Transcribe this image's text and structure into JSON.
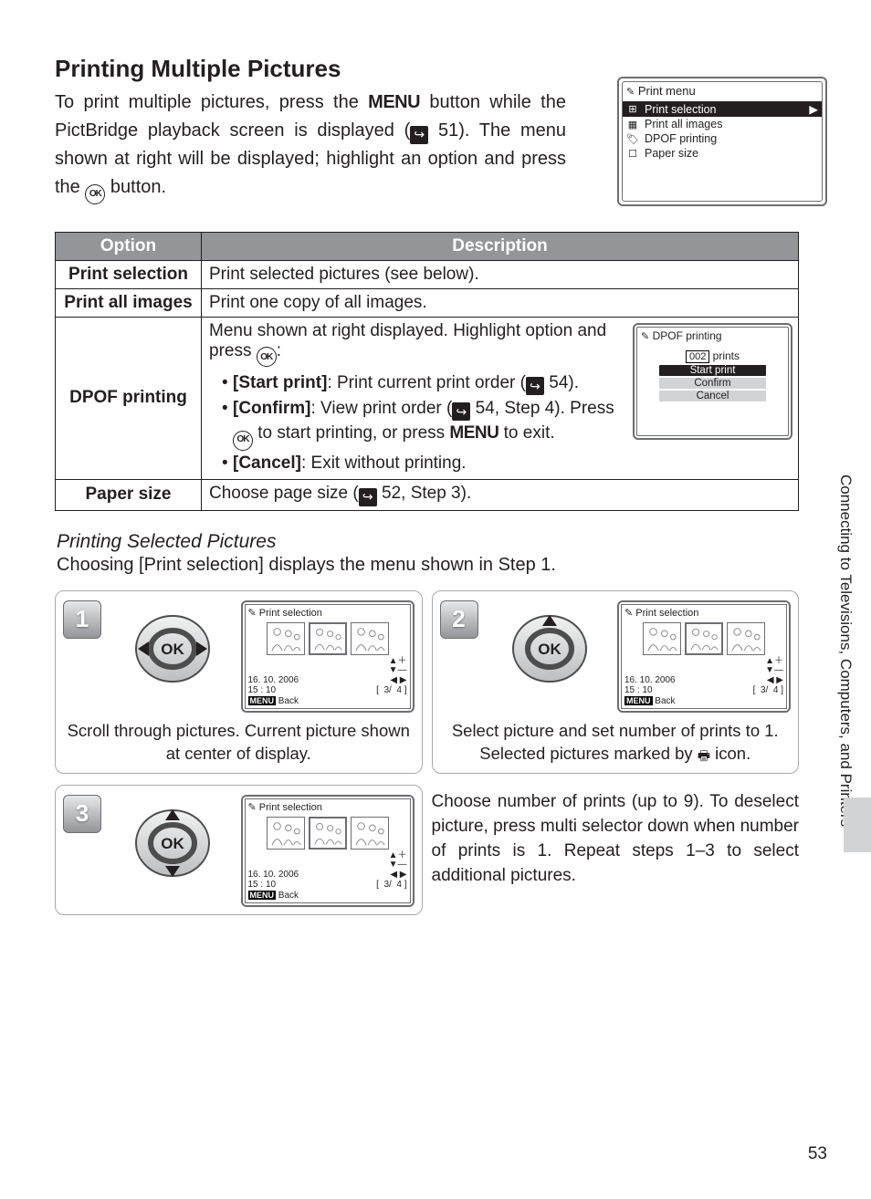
{
  "heading": "Printing Multiple Pictures",
  "intro": {
    "part1": "To print multiple pictures, press the ",
    "menu": "MENU",
    "part2": " button while the PictBridge playback screen is displayed (",
    "pageref1": " 51).  The menu shown at right will be displayed; highlight an option and press the ",
    "part3": " button."
  },
  "print_menu": {
    "title": "Print menu",
    "items": [
      "Print selection",
      "Print all images",
      "DPOF printing",
      "Paper size"
    ],
    "selected_index": 0
  },
  "opts_table": {
    "head_option": "Option",
    "head_desc": "Description",
    "rows": {
      "print_selection": {
        "label": "Print selection",
        "desc": "Print selected pictures (see below)."
      },
      "print_all": {
        "label": "Print all images",
        "desc": "Print one copy of all images."
      },
      "dpof": {
        "label": "DPOF printing",
        "intro_a": "Menu shown at right displayed.  Highlight option and press ",
        "intro_b": ":",
        "start_label": "[Start print]",
        "start_text": ": Print current print order (",
        "start_page": " 54).",
        "confirm_label": "[Confirm]",
        "confirm_text_a": ": View print order (",
        "confirm_page": " 54, Step 4).  Press ",
        "confirm_text_b": " to start printing, or press ",
        "confirm_menu": "MENU",
        "confirm_text_c": " to exit.",
        "cancel_label": "[Cancel]",
        "cancel_text": ": Exit without printing."
      },
      "paper_size": {
        "label": "Paper size",
        "desc_a": "Choose page size (",
        "desc_page": " 52, Step 3)."
      }
    }
  },
  "dpof_popup": {
    "title": "DPOF printing",
    "prints_value": "002",
    "prints_label": "prints",
    "items": [
      "Start print",
      "Confirm",
      "Cancel"
    ],
    "selected_index": 0
  },
  "sub": {
    "heading": "Printing Selected Pictures",
    "desc": "Choosing [Print selection] displays the menu shown in Step 1."
  },
  "lcd": {
    "title": "Print selection",
    "date": "16. 10. 2006",
    "time": "15 : 10",
    "counter_left": "3/",
    "counter_right": "4",
    "back": "Back",
    "menu_tag": "MENU",
    "up_plus": "▲＋",
    "down_minus": "▼—",
    "left_right": "◀    ▶"
  },
  "steps": {
    "s1": {
      "num": "1",
      "caption": "Scroll through pictures.  Current picture shown at center of display."
    },
    "s2": {
      "num": "2",
      "caption_a": "Select picture and set number of prints to 1.  Selected pictures marked by ",
      "caption_b": " icon."
    },
    "s3": {
      "num": "3",
      "side_text": "Choose number of prints (up to 9).  To deselect picture, press multi selector down when number of prints is 1.  Repeat steps 1–3 to select additional pictures."
    }
  },
  "side_label": "Connecting to Televisions, Computers, and Printers",
  "page_number": "53"
}
